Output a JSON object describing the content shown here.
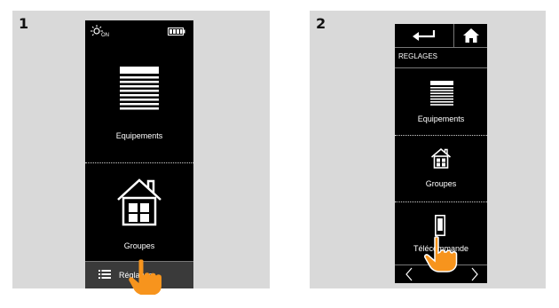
{
  "step1": {
    "number": "1",
    "status": {
      "on_label": "ON",
      "sun_icon": "sun-icon",
      "battery_icon": "battery-icon"
    },
    "tiles": [
      {
        "label": "Equipements",
        "icon": "blind-icon"
      },
      {
        "label": "Groupes",
        "icon": "house-icon"
      }
    ],
    "bottom_bar": {
      "menu_icon": "menu-icon",
      "label": "Réglages"
    },
    "pointer": "hand-pointer-icon"
  },
  "step2": {
    "number": "2",
    "nav": {
      "back_icon": "back-arrow-icon",
      "home_icon": "home-icon"
    },
    "title": "REGLAGES",
    "items": [
      {
        "label": "Equipements",
        "icon": "blind-icon"
      },
      {
        "label": "Groupes",
        "icon": "house-icon"
      },
      {
        "label": "Télécommande",
        "icon": "remote-control-icon"
      }
    ],
    "pager": {
      "prev_icon": "chevron-left-icon",
      "next_icon": "chevron-right-icon"
    },
    "pointer": "hand-pointer-icon"
  },
  "colors": {
    "panel_bg": "#d9d9d9",
    "device_bg": "#000000",
    "bar_bg": "#3a3a3a",
    "hand": "#f7941d"
  }
}
